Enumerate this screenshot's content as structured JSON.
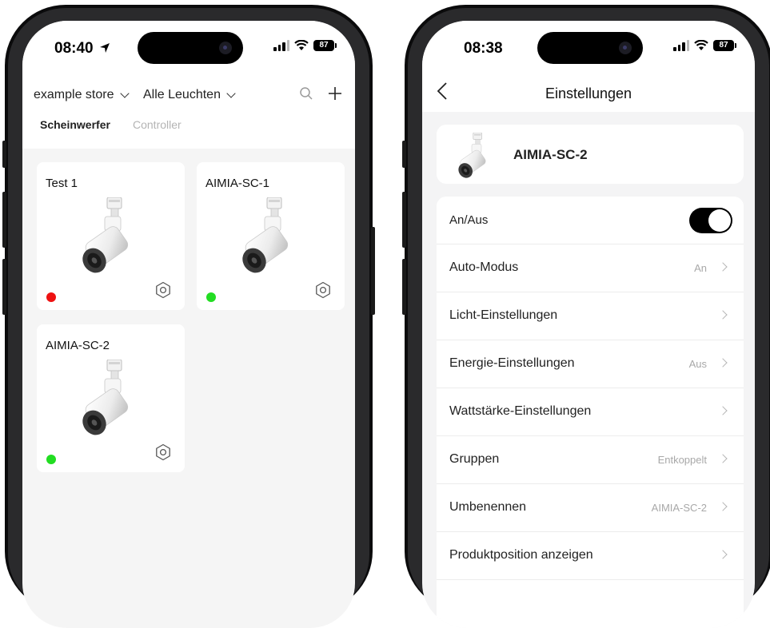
{
  "left_phone": {
    "status": {
      "time": "08:40",
      "battery": "87"
    },
    "header": {
      "store_dropdown": "example store",
      "lights_dropdown": "Alle Leuchten",
      "search_icon": "search-icon",
      "add_icon": "plus-icon"
    },
    "tabs": [
      {
        "label": "Scheinwerfer",
        "active": true
      },
      {
        "label": "Controller",
        "active": false
      }
    ],
    "devices": [
      {
        "name": "Test 1",
        "status_color": "#ee1111"
      },
      {
        "name": "AIMIA-SC-1",
        "status_color": "#22dd22"
      },
      {
        "name": "AIMIA-SC-2",
        "status_color": "#22dd22"
      }
    ]
  },
  "right_phone": {
    "status": {
      "time": "08:38",
      "battery": "87"
    },
    "nav": {
      "title": "Einstellungen",
      "back_icon": "chevron-left-icon"
    },
    "device": {
      "name": "AIMIA-SC-2"
    },
    "settings": [
      {
        "label": "An/Aus",
        "value": "",
        "toggle": true,
        "on": true
      },
      {
        "label": "Auto-Modus",
        "value": "An"
      },
      {
        "label": "Licht-Einstellungen",
        "value": ""
      },
      {
        "label": "Energie-Einstellungen",
        "value": "Aus"
      },
      {
        "label": "Wattstärke-Einstellungen",
        "value": ""
      },
      {
        "label": "Gruppen",
        "value": "Entkoppelt"
      },
      {
        "label": "Umbenennen",
        "value": "AIMIA-SC-2"
      },
      {
        "label": "Produktposition anzeigen",
        "value": ""
      }
    ]
  }
}
